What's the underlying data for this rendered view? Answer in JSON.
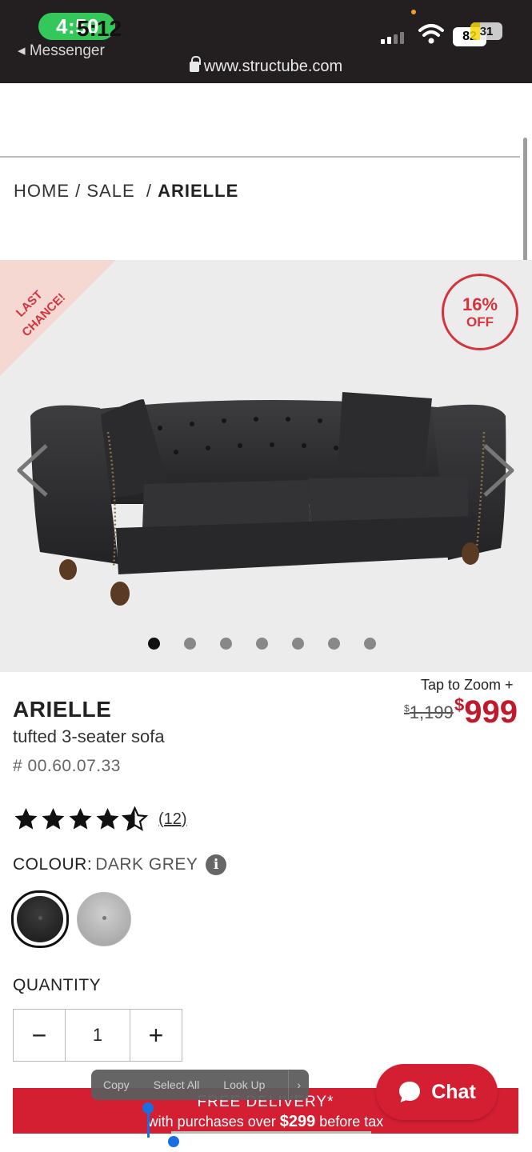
{
  "status_bar": {
    "time": "4:50",
    "time_overlay": "5:12",
    "back_app": "◂ Messenger",
    "battery_level": "82",
    "battery_level_2": "31",
    "url": "www.structube.com"
  },
  "breadcrumb": {
    "home": "HOME",
    "sep1": "/",
    "sale": "SALE",
    "sep2": "/",
    "current": "ARIELLE"
  },
  "gallery": {
    "ribbon_text_1": "LAST",
    "ribbon_text_2": "CHANCE!",
    "discount_pct": "16%",
    "discount_word": "OFF",
    "dot_count": 7,
    "active_dot": 0
  },
  "product": {
    "tap_to_zoom": "Tap to Zoom +",
    "price_old_symbol": "$",
    "price_old": "1,199",
    "price_new_symbol": "$",
    "price_new": "999",
    "name": "ARIELLE",
    "description": "tufted 3-seater sofa",
    "sku": "# 00.60.07.33",
    "rating": 4.5,
    "review_count": "(12)",
    "colour_label": "COLOUR:",
    "colour_value": "DARK GREY",
    "info_symbol": "i",
    "swatches": [
      "dark-grey",
      "light-grey"
    ],
    "quantity_label": "QUANTITY",
    "quantity_value": "1",
    "minus": "−",
    "plus": "+"
  },
  "selection_menu": {
    "copy": "Copy",
    "select_all": "Select All",
    "look_up": "Look Up",
    "more": "›"
  },
  "delivery_banner": {
    "line1": "FREE DELIVERY*",
    "line2_a": "with purchases over ",
    "line2_amount": "$299",
    "line2_b": " before tax"
  },
  "chat": {
    "label": "Chat"
  },
  "colors": {
    "brand_red": "#d41f33",
    "price_red": "#c2182b",
    "status_green": "#34c759"
  }
}
